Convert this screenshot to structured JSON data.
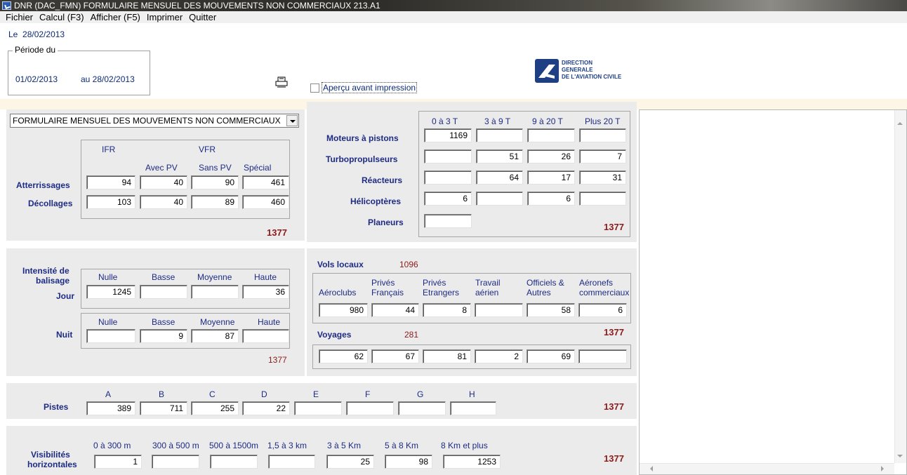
{
  "window": {
    "title": "DNR  (DAC_FMN) FORMULAIRE MENSUEL DES MOUVEMENTS NON COMMERCIAUX 213.A1"
  },
  "menu": [
    "Fichier",
    "Calcul (F3)",
    "Afficher (F5)",
    "Imprimer",
    "Quitter"
  ],
  "header": {
    "date_prefix": "Le",
    "date": "28/02/2013",
    "periode_label": "Période du",
    "periode_from": "01/02/2013",
    "periode_to": "au 28/02/2013",
    "apercu_label": "Aperçu avant impression",
    "apercu_checked": false,
    "logo_lines": [
      "DIRECTION",
      "GENERALE",
      "DE L'AVIATION CIVILE"
    ]
  },
  "combo": {
    "value": "FORMULAIRE MENSUEL DES MOUVEMENTS NON COMMERCIAUX"
  },
  "mouvements": {
    "ifr": "IFR",
    "vfr": "VFR",
    "cols": [
      "Avec PV",
      "Sans PV",
      "Spécial"
    ],
    "rows": [
      {
        "label": "Atterrissages",
        "values": [
          "94",
          "40",
          "90",
          "461"
        ]
      },
      {
        "label": "Décollages",
        "values": [
          "103",
          "40",
          "89",
          "460"
        ]
      }
    ],
    "total": "1377"
  },
  "aeronefs": {
    "cols": [
      "0 à 3 T",
      "3 à 9 T",
      "9 à 20 T",
      "Plus 20 T"
    ],
    "rows": [
      {
        "label": "Moteurs à pistons",
        "values": [
          "1169",
          "",
          "",
          ""
        ]
      },
      {
        "label": "Turbopropulseurs",
        "values": [
          "",
          "51",
          "26",
          "7"
        ]
      },
      {
        "label": "Réacteurs",
        "values": [
          "",
          "64",
          "17",
          "31"
        ]
      },
      {
        "label": "Hélicoptères",
        "values": [
          "6",
          "",
          "6",
          ""
        ]
      },
      {
        "label": "Planeurs",
        "values": [
          ""
        ]
      }
    ],
    "total": "1377"
  },
  "balisage": {
    "title": [
      "Intensité de",
      "balisage",
      "Jour"
    ],
    "cols": [
      "Nulle",
      "Basse",
      "Moyenne",
      "Haute"
    ],
    "jour": [
      "1245",
      "",
      "",
      "36"
    ],
    "nuit_label": "Nuit",
    "nuit": [
      "",
      "9",
      "87",
      ""
    ],
    "total": "1377"
  },
  "vols": {
    "locaux_label": "Vols locaux",
    "locaux_total": "1096",
    "cols": [
      "Aéroclubs",
      "Privés\nFrançais",
      "Privés\nEtrangers",
      "Travail\naérien",
      "Officiels &\nAutres",
      "Aéronefs\ncommerciaux"
    ],
    "locaux": [
      "980",
      "44",
      "8",
      "",
      "58",
      "6"
    ],
    "total": "1377",
    "voyages_label": "Voyages",
    "voyages_total": "281",
    "voyages": [
      "62",
      "67",
      "81",
      "2",
      "69",
      ""
    ]
  },
  "pistes": {
    "label": "Pistes",
    "cols": [
      "A",
      "B",
      "C",
      "D",
      "E",
      "F",
      "G",
      "H"
    ],
    "values": [
      "389",
      "711",
      "255",
      "22",
      "",
      "",
      "",
      ""
    ],
    "total": "1377"
  },
  "visibilites": {
    "label": [
      "Visibilités",
      "horizontales"
    ],
    "cols": [
      "0 à 300 m",
      "300 à 500 m",
      "500 à 1500m",
      "1,5 à 3 km",
      "3 à 5 Km",
      "5 à 8 Km",
      "8 Km et plus"
    ],
    "values": [
      "1",
      "",
      "",
      "",
      "25",
      "98",
      "1253"
    ],
    "total": "1377"
  },
  "colors": {
    "label_blue": "#1d2b84",
    "total_red": "#8b1a1a",
    "panel_gray": "#ebebeb"
  }
}
